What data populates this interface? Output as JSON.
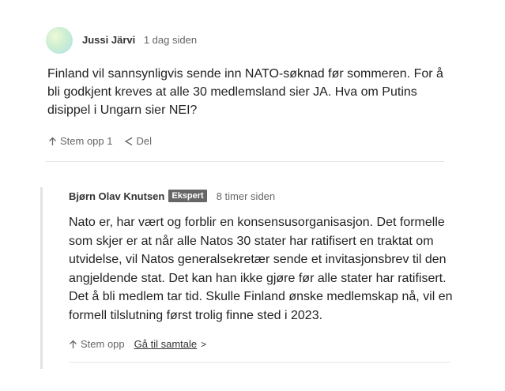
{
  "comments": [
    {
      "author": "Jussi Järvi",
      "time": "1 dag siden",
      "body": "Finland vil sannsynligvis sende inn NATO-søknad før sommeren. For å bli godkjent kreves at alle 30 medlemsland sier JA. Hva om Putins disippel i Ungarn sier NEI?",
      "upvote_label": "Stem opp 1",
      "share_label": "Del"
    }
  ],
  "reply": {
    "author": "Bjørn Olav Knutsen",
    "badge": "Ekspert",
    "time": "8 timer siden",
    "body": "Nato er, har vært og forblir en konsensusorganisasjon. Det formelle som skjer er at når alle Natos 30 stater har ratifisert en traktat om utvidelse, vil Natos generalsekretær sende et invitasjonsbrev til den angjeldende stat. Det kan han ikke gjøre før alle stater har ratifisert. Det å bli medlem tar tid. Skulle Finland ønske medlemskap nå, vil en formell tilslutning først trolig finne sted i 2023.",
    "upvote_label": "Stem opp",
    "goto_label": "Gå til samtale",
    "goto_chevron": ">"
  },
  "icons": {
    "upvote": "arrow-up-icon",
    "share": "share-icon",
    "avatar": "avatar"
  }
}
